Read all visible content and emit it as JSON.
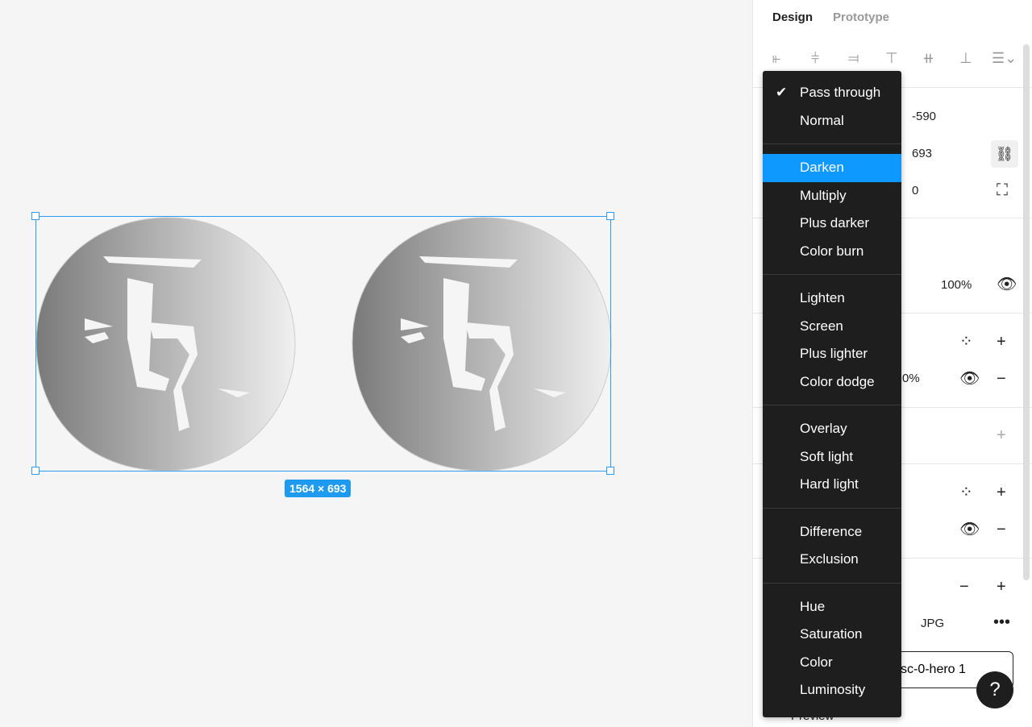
{
  "tabs": [
    "Design",
    "Prototype"
  ],
  "position": {
    "y": "-590",
    "h": "693",
    "rotation": "0"
  },
  "layer": {
    "opacity": "100%"
  },
  "fill": {
    "opacity_partial": "0%"
  },
  "export": {
    "format": "JPG",
    "button_partial": "sc-0-hero 1"
  },
  "preview_label": "Preview",
  "selection_size": "1564 × 693",
  "blend_menu": {
    "selected": "Pass through",
    "highlighted": "Darken",
    "groups": [
      [
        "Pass through",
        "Normal"
      ],
      [
        "Darken",
        "Multiply",
        "Plus darker",
        "Color burn"
      ],
      [
        "Lighten",
        "Screen",
        "Plus lighter",
        "Color dodge"
      ],
      [
        "Overlay",
        "Soft light",
        "Hard light"
      ],
      [
        "Difference",
        "Exclusion"
      ],
      [
        "Hue",
        "Saturation",
        "Color",
        "Luminosity"
      ]
    ]
  },
  "help": "?",
  "colors": {
    "accent": "#0d99ff",
    "menu_bg": "#1e1e1e"
  }
}
